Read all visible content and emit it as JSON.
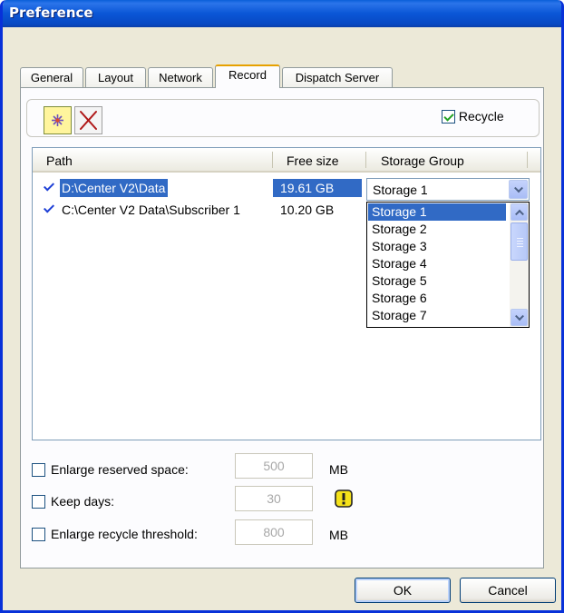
{
  "window": {
    "title": "Preference"
  },
  "tabs": [
    {
      "label": "General",
      "active": false
    },
    {
      "label": "Layout",
      "active": false
    },
    {
      "label": "Network",
      "active": false
    },
    {
      "label": "Record",
      "active": true
    },
    {
      "label": "Dispatch Server",
      "active": false
    }
  ],
  "toolbar": {
    "new_icon": "new-storage-icon",
    "delete_icon": "delete-icon",
    "recycle_label": "Recycle",
    "recycle_checked": true
  },
  "storage_list": {
    "columns": [
      "Path",
      "Free size",
      "Storage Group"
    ],
    "rows": [
      {
        "checked": true,
        "path": "D:\\Center V2\\Data",
        "free_size": "19.61 GB",
        "selected": true
      },
      {
        "checked": true,
        "path": "C:\\Center V2 Data\\Subscriber 1",
        "free_size": "10.20 GB",
        "selected": false
      }
    ]
  },
  "storage_group_combo": {
    "value": "Storage 1",
    "options": [
      "Storage 1",
      "Storage 2",
      "Storage 3",
      "Storage 4",
      "Storage 5",
      "Storage 6",
      "Storage 7"
    ],
    "highlighted": "Storage 1"
  },
  "options": {
    "enlarge_reserved": {
      "label": "Enlarge reserved space:",
      "value": "500",
      "unit": "MB",
      "checked": false
    },
    "keep_days": {
      "label": "Keep days:",
      "value": "30",
      "warning_icon": "warning-icon",
      "checked": false
    },
    "enlarge_recycle": {
      "label": "Enlarge recycle threshold:",
      "value": "800",
      "unit": "MB",
      "checked": false
    }
  },
  "buttons": {
    "ok": "OK",
    "cancel": "Cancel"
  },
  "colors": {
    "selection": "#316ac5",
    "titlebar": "#0a56d6",
    "dialog_bg": "#ece9d8"
  }
}
